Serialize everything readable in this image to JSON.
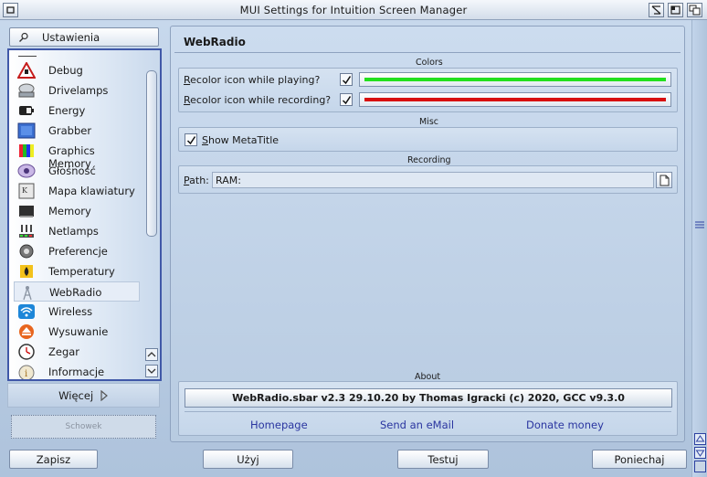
{
  "window": {
    "title": "MUI Settings for Intuition Screen Manager"
  },
  "sidebar": {
    "search_label": "Ustawienia",
    "items": [
      {
        "label": "Debug",
        "icon": "warning-triangle-icon"
      },
      {
        "label": "Drivelamps",
        "icon": "drive-icon"
      },
      {
        "label": "Energy",
        "icon": "battery-icon"
      },
      {
        "label": "Grabber",
        "icon": "screen-grabber-icon"
      },
      {
        "label": "Graphics Memory",
        "icon": "graphics-memory-icon"
      },
      {
        "label": "Głośność",
        "icon": "speaker-icon"
      },
      {
        "label": "Mapa klawiatury",
        "icon": "keyboard-icon"
      },
      {
        "label": "Memory",
        "icon": "memory-icon"
      },
      {
        "label": "Netlamps",
        "icon": "network-lamps-icon"
      },
      {
        "label": "Preferencje",
        "icon": "gear-icon"
      },
      {
        "label": "Temperatury",
        "icon": "flame-icon"
      },
      {
        "label": "WebRadio",
        "icon": "radio-tower-icon"
      },
      {
        "label": "Wireless",
        "icon": "wifi-icon"
      },
      {
        "label": "Wysuwanie",
        "icon": "eject-icon"
      },
      {
        "label": "Zegar",
        "icon": "clock-icon"
      },
      {
        "label": "Informacje",
        "icon": "info-icon"
      }
    ],
    "selected": "WebRadio",
    "more_label": "Więcej",
    "clipboard_label": "Schowek"
  },
  "panel": {
    "title": "WebRadio",
    "colors": {
      "group_label": "Colors",
      "playing_prefix": "R",
      "playing_rest": "ecolor icon while playing?",
      "recording_prefix": "R",
      "recording_rest": "ecolor icon while recording?",
      "playing_checked": true,
      "recording_checked": true,
      "playing_color": "#22e01e",
      "recording_color": "#d81010"
    },
    "misc": {
      "group_label": "Misc",
      "show_prefix": "S",
      "show_rest": "how MetaTitle",
      "show_checked": true
    },
    "recording": {
      "group_label": "Recording",
      "path_prefix": "P",
      "path_rest": "ath:",
      "path_value": "RAM:"
    },
    "about": {
      "group_label": "About",
      "version_text": "WebRadio.sbar v2.3 29.10.20 by Thomas Igracki (c) 2020, GCC v9.3.0",
      "links": [
        "Homepage",
        "Send an eMail",
        "Donate money"
      ]
    }
  },
  "buttons": {
    "save": "Zapisz",
    "use": "Użyj",
    "test": "Testuj",
    "cancel": "Poniechaj"
  }
}
